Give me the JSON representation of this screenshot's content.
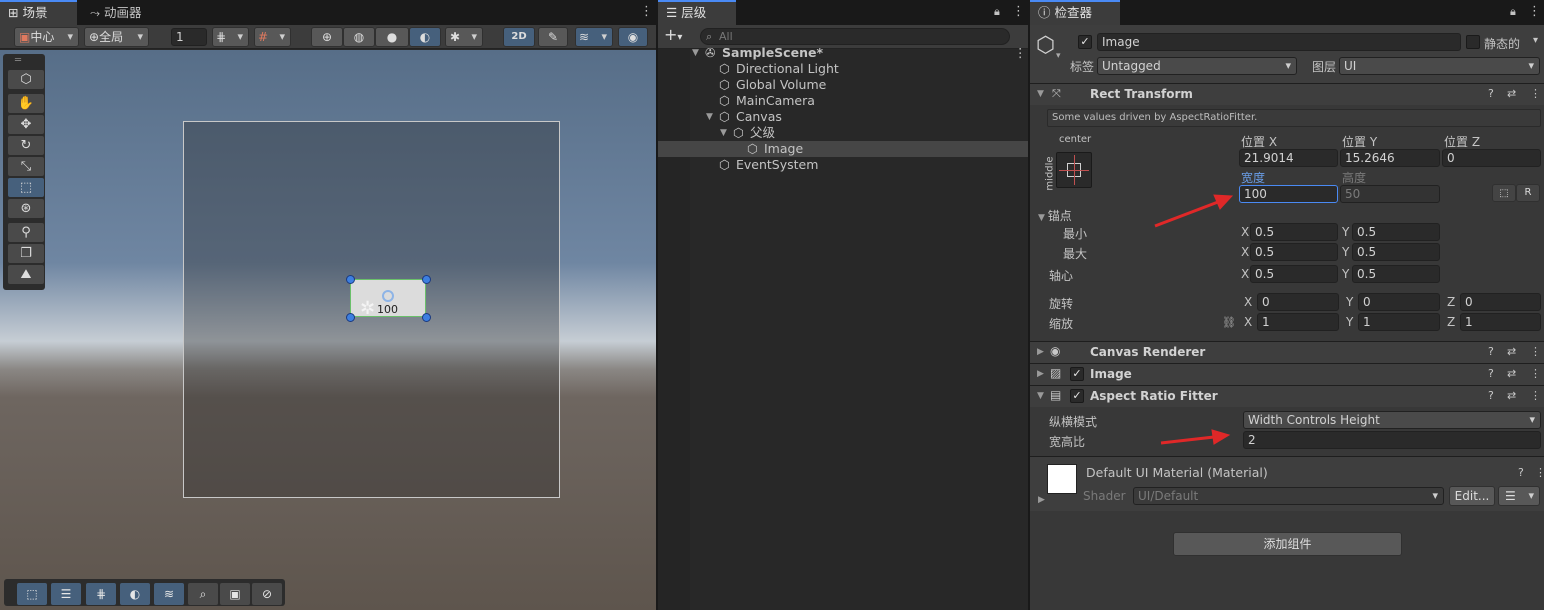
{
  "scene": {
    "tabs": [
      {
        "label": "场景",
        "icon": "grid-icon"
      },
      {
        "label": "动画器",
        "icon": "animator-icon"
      }
    ],
    "pivot_mode": "中心",
    "handle_space": "全局",
    "grid_value": "1",
    "selection_label": "100",
    "btn_2d": "2D"
  },
  "hierarchy": {
    "tab_label": "层级",
    "search_placeholder": "All",
    "scene_name": "SampleScene*",
    "items": [
      {
        "label": "Directional Light"
      },
      {
        "label": "Global Volume"
      },
      {
        "label": "MainCamera"
      },
      {
        "label": "Canvas"
      },
      {
        "label": "父级"
      },
      {
        "label": "Image"
      },
      {
        "label": "EventSystem"
      }
    ]
  },
  "inspector": {
    "tab_label": "检查器",
    "object_name": "Image",
    "static_label": "静态的",
    "tag_label": "标签",
    "tag_value": "Untagged",
    "layer_label": "图层",
    "layer_value": "UI",
    "rect": {
      "title": "Rect Transform",
      "note": "Some values driven by AspectRatioFitter.",
      "anchor_h": "center",
      "anchor_v": "middle",
      "pos_x_label": "位置 X",
      "pos_y_label": "位置 Y",
      "pos_z_label": "位置 Z",
      "pos_x": "21.9014",
      "pos_y": "15.2646",
      "pos_z": "0",
      "width_label": "宽度",
      "height_label": "高度",
      "width": "100",
      "height": "50",
      "r_label": "R",
      "anchors_label": "锚点",
      "min_label": "最小",
      "max_label": "最大",
      "pivot_label": "轴心",
      "rotation_label": "旋转",
      "scale_label": "缩放",
      "x": "X",
      "y": "Y",
      "z": "Z",
      "min_x": "0.5",
      "min_y": "0.5",
      "max_x": "0.5",
      "max_y": "0.5",
      "pivot_x": "0.5",
      "pivot_y": "0.5",
      "rot_x": "0",
      "rot_y": "0",
      "rot_z": "0",
      "scale_x": "1",
      "scale_y": "1",
      "scale_z": "1"
    },
    "canvas_renderer": "Canvas Renderer",
    "image_comp": "Image",
    "aspect": {
      "title": "Aspect Ratio Fitter",
      "mode_label": "纵横模式",
      "mode_value": "Width Controls Height",
      "ratio_label": "宽高比",
      "ratio_value": "2"
    },
    "material": {
      "name": "Default UI Material (Material)",
      "shader_label": "Shader",
      "shader_value": "UI/Default",
      "edit_label": "Edit..."
    },
    "add_component": "添加组件"
  },
  "colors": {
    "accent": "#4a8af4",
    "arrow": "#e02828",
    "selected_button": "#46607c"
  }
}
